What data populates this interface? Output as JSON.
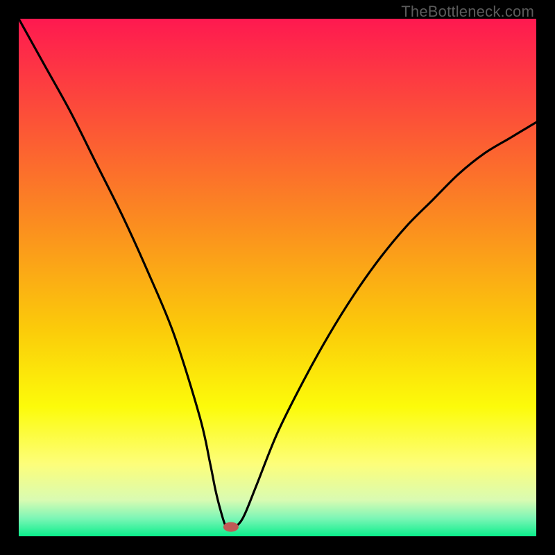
{
  "watermark": "TheBottleneck.com",
  "chart_data": {
    "type": "line",
    "title": "",
    "xlabel": "",
    "ylabel": "",
    "xlim": [
      0,
      100
    ],
    "ylim": [
      0,
      100
    ],
    "series": [
      {
        "name": "bottleneck-curve",
        "x": [
          0,
          5,
          10,
          15,
          20,
          25,
          30,
          35,
          37,
          38,
          39,
          40,
          41,
          42,
          43,
          44,
          46,
          50,
          55,
          60,
          65,
          70,
          75,
          80,
          85,
          90,
          95,
          100
        ],
        "values": [
          100,
          91,
          82,
          72,
          62,
          51,
          39,
          23,
          14,
          9,
          5,
          2,
          2,
          2,
          3,
          5,
          10,
          20,
          30,
          39,
          47,
          54,
          60,
          65,
          70,
          74,
          77,
          80
        ]
      }
    ],
    "marker": {
      "x": 41,
      "y": 1.8,
      "color": "#c05a56"
    },
    "gradient_stops": [
      {
        "offset": 0.0,
        "color": "#fe1950"
      },
      {
        "offset": 0.2,
        "color": "#fc5337"
      },
      {
        "offset": 0.4,
        "color": "#fb8e1f"
      },
      {
        "offset": 0.6,
        "color": "#fbcb0a"
      },
      {
        "offset": 0.75,
        "color": "#fcfb0a"
      },
      {
        "offset": 0.86,
        "color": "#fdfe7a"
      },
      {
        "offset": 0.93,
        "color": "#d9fbb2"
      },
      {
        "offset": 0.965,
        "color": "#7df6b6"
      },
      {
        "offset": 1.0,
        "color": "#0bee8c"
      }
    ]
  }
}
